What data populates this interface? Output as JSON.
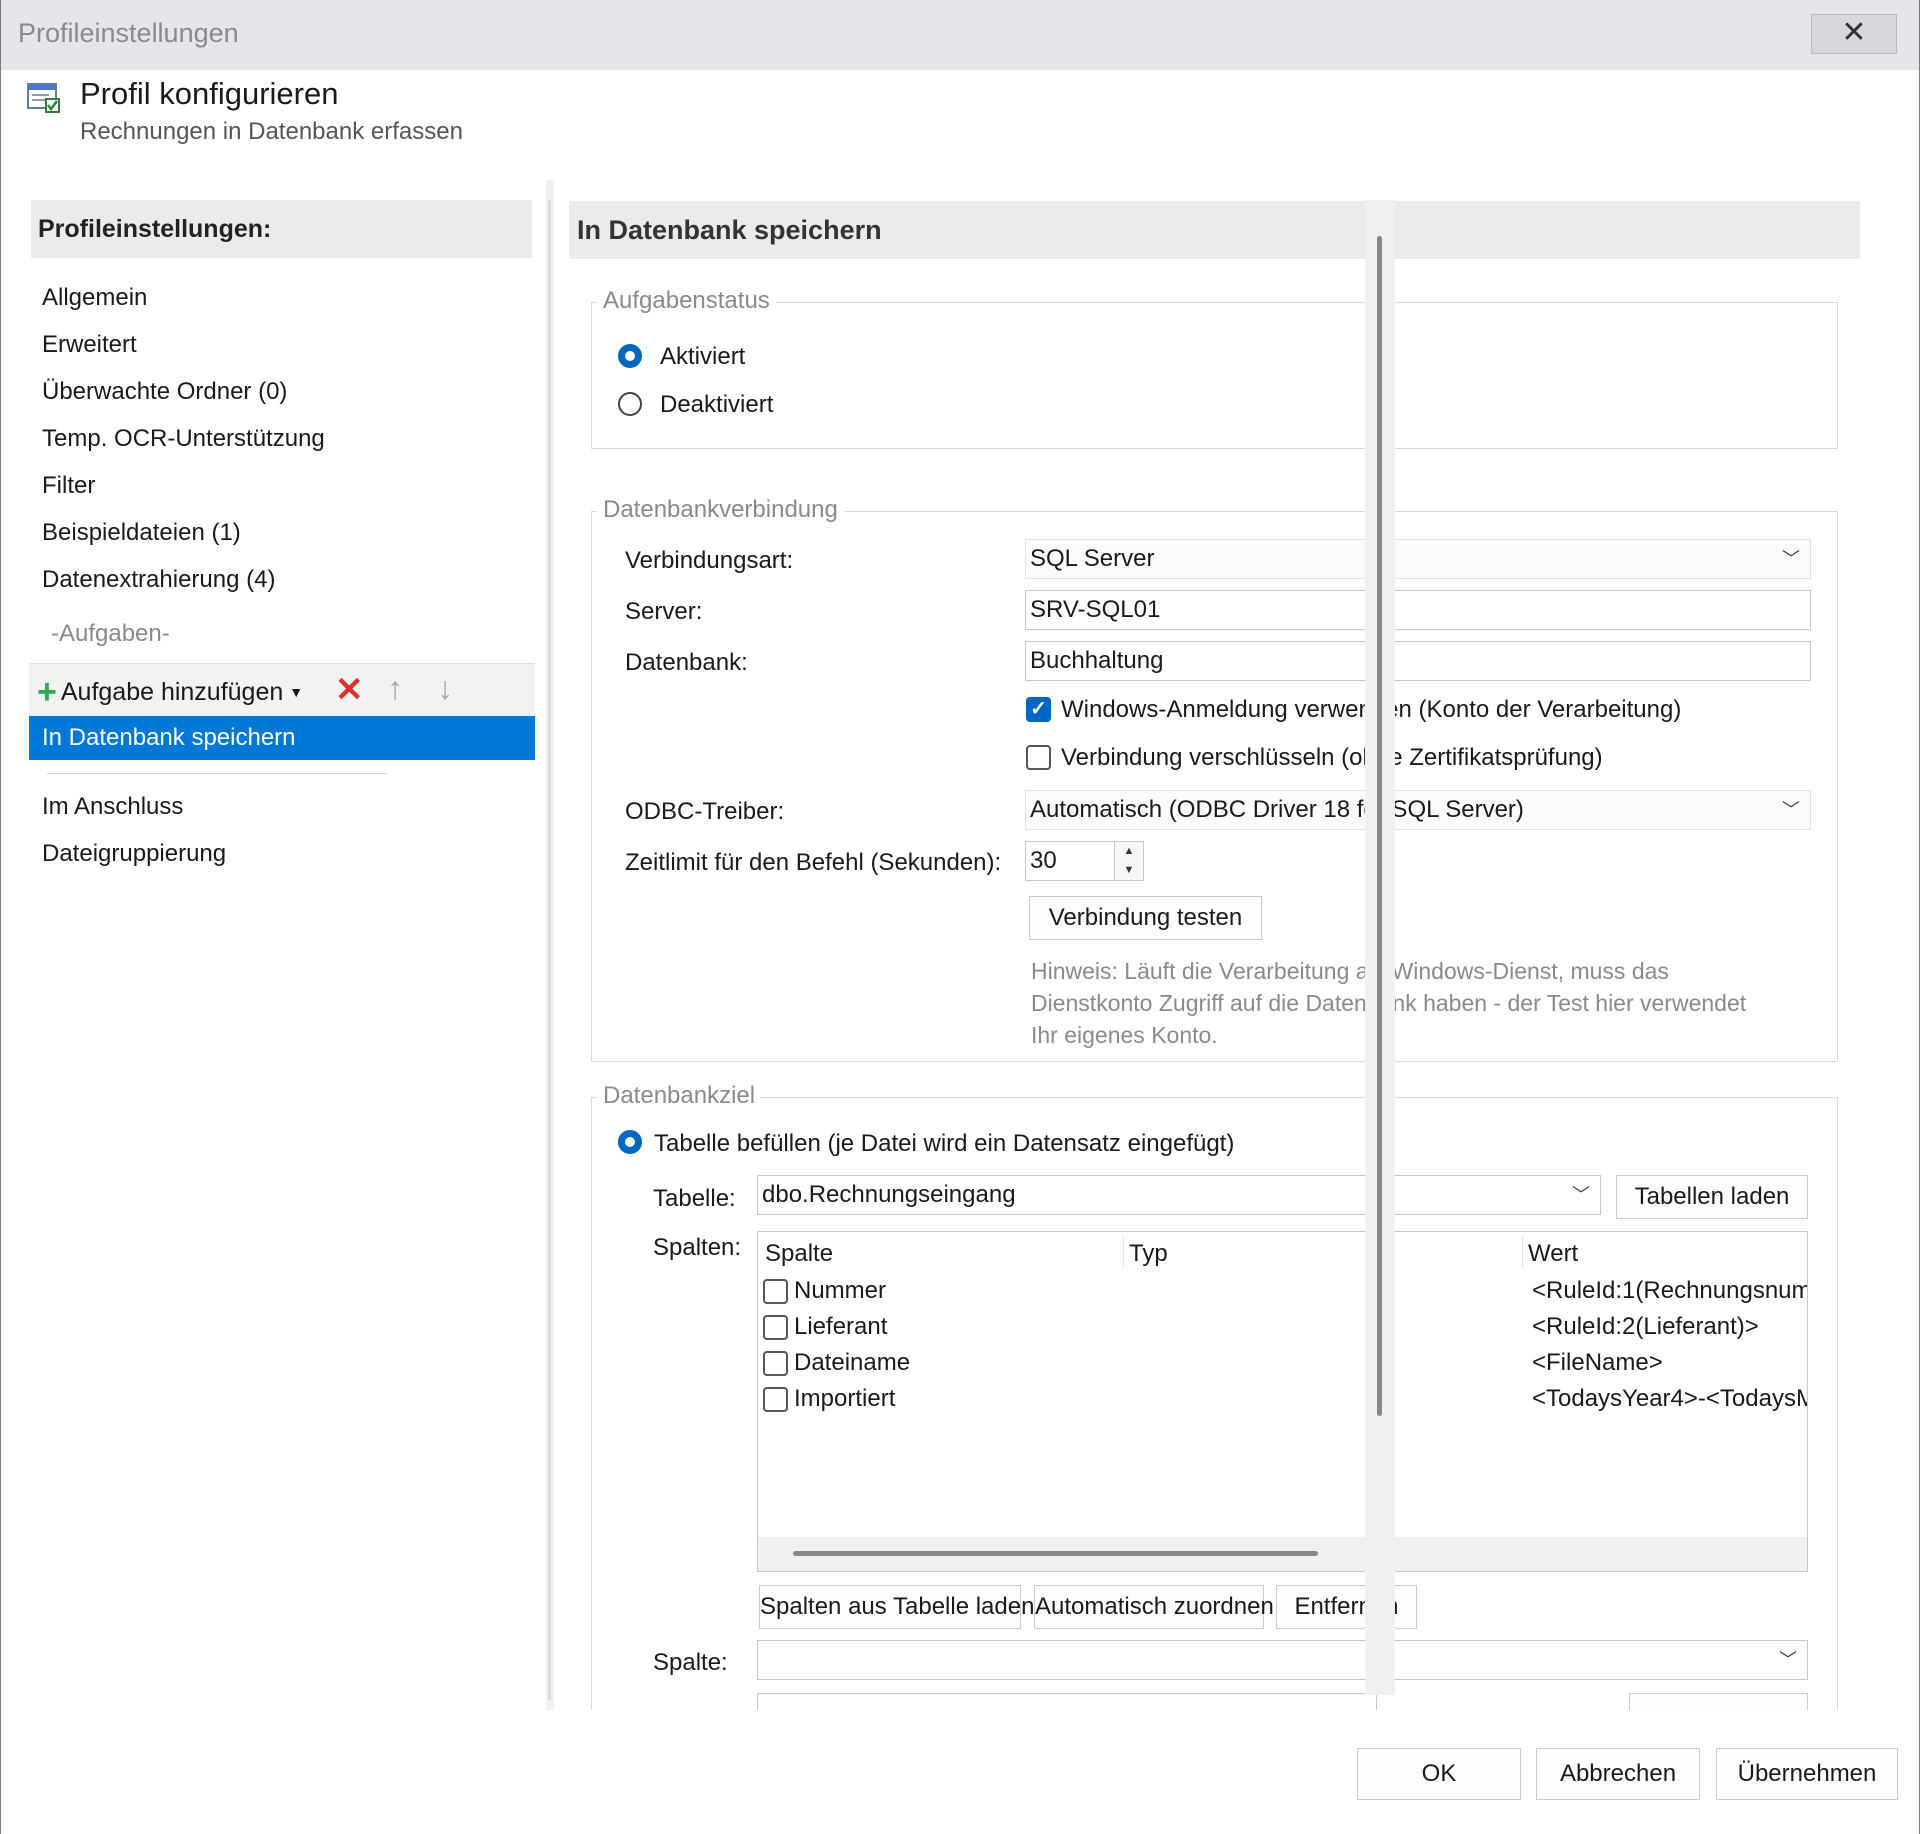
{
  "window": {
    "title": "Profileinstellungen",
    "close_glyph": "✕"
  },
  "header": {
    "title": "Profil konfigurieren",
    "subtitle": "Rechnungen in Datenbank erfassen",
    "icon": "profile-config-icon"
  },
  "left": {
    "title": "Profileinstellungen:",
    "items": [
      "Allgemein",
      "Erweitert",
      "Überwachte Ordner (0)",
      "Temp. OCR-Unterstützung",
      "Filter",
      "Beispieldateien (1)",
      "Datenextrahierung (4)"
    ],
    "tasks_section": "-Aufgaben-",
    "toolbar": {
      "add_label": "Aufgabe hinzufügen",
      "delete_icon": "delete-icon",
      "up_icon": "arrow-up-icon",
      "down_icon": "arrow-down-icon"
    },
    "selected_task": "In Datenbank speichern",
    "after_items": [
      "Im Anschluss",
      "Dateigruppierung"
    ]
  },
  "right": {
    "title": "In Datenbank speichern",
    "status_group": {
      "legend": "Aufgabenstatus",
      "options": [
        "Aktiviert",
        "Deaktiviert"
      ],
      "selected": "Aktiviert"
    },
    "connection_group": {
      "legend": "Datenbankverbindung",
      "type_label": "Verbindungsart:",
      "type_value": "SQL Server",
      "server_label": "Server:",
      "server_value": "SRV-SQL01",
      "db_label": "Datenbank:",
      "db_value": "Buchhaltung",
      "windows_login_label": "Windows-Anmeldung verwenden (Konto der Verarbeitung)",
      "windows_login_checked": true,
      "encrypt_label": "Verbindung verschlüsseln (ohne Zertifikatsprüfung)",
      "encrypt_checked": false,
      "odbc_label": "ODBC-Treiber:",
      "odbc_value": "Automatisch (ODBC Driver 18 for SQL Server)",
      "timeout_label": "Zeitlimit für den Befehl (Sekunden):",
      "timeout_value": "30",
      "test_button": "Verbindung testen",
      "hint_lines": [
        "Hinweis: Läuft die Verarbeitung als Windows-Dienst, muss das",
        "Dienstkonto Zugriff auf die Datenbank haben - der Test hier verwendet",
        "Ihr eigenes Konto."
      ]
    },
    "target_group": {
      "legend": "Datenbankziel",
      "fill_table_label": "Tabelle befüllen (je Datei wird ein Datensatz eingefügt)",
      "table_label": "Tabelle:",
      "table_value": "dbo.Rechnungseingang",
      "load_tables_button": "Tabellen laden",
      "columns_label": "Spalten:",
      "list_headers": [
        "Spalte",
        "Typ",
        "Wert"
      ],
      "rows": [
        {
          "name": "Nummer",
          "typ": "",
          "wert": "<RuleId:1(Rechnungsnumr"
        },
        {
          "name": "Lieferant",
          "typ": "",
          "wert": "<RuleId:2(Lieferant)>"
        },
        {
          "name": "Dateiname",
          "typ": "",
          "wert": "<FileName>"
        },
        {
          "name": "Importiert",
          "typ": "",
          "wert": "<TodaysYear4>-<TodaysM"
        }
      ],
      "load_columns_button": "Spalten aus Tabelle laden",
      "auto_assign_button": "Automatisch zuordnen",
      "remove_button": "Entfernen",
      "column_label": "Spalte:",
      "column_value": ""
    }
  },
  "footer": {
    "ok": "OK",
    "cancel": "Abbrechen",
    "apply": "Übernehmen"
  },
  "colors": {
    "accent": "#0078d7",
    "radio_checkbox": "#0067c0",
    "delete": "#d9322c",
    "add": "#2fa84f"
  }
}
